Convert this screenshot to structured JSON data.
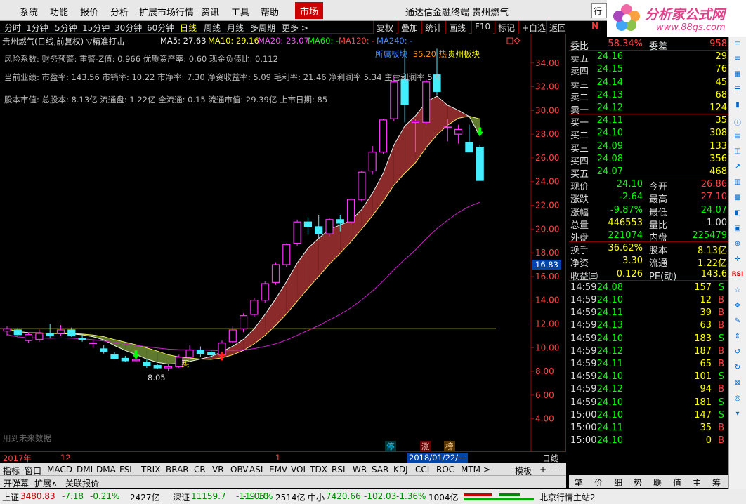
{
  "menu": {
    "items": [
      "系统",
      "功能",
      "报价",
      "分析",
      "扩展市场行情",
      "资讯",
      "工具",
      "帮助"
    ],
    "market": "市场",
    "title": "通达信金融终端   贵州燃气",
    "box": "行"
  },
  "logo": {
    "title": "分析家公式网",
    "url": "www.88gs.com"
  },
  "toolbar": {
    "periods": [
      "分时",
      "1分钟",
      "5分钟",
      "15分钟",
      "30分钟",
      "60分钟",
      "日线",
      "周线",
      "月线",
      "多周期",
      "更多 >"
    ],
    "active": "日线",
    "buttons": [
      "复权",
      "叠加",
      "统计",
      "画线",
      "F10",
      "标记",
      "+自选",
      "返回"
    ]
  },
  "indicators": {
    "header": "贵州燃气(日线,前复权) ▽精准打击",
    "ma5": "MA5: 27.63",
    "ma10": "MA10: 29.16",
    "ma20": "MA20: 23.07",
    "ma60": "MA60: -",
    "ma120": "MA120: -",
    "ma240": "MA240: -"
  },
  "info": {
    "line1": "风险系数: 财务预警: 重警-Z值: 0.966 优质资产率: 0.60 现金负债比: 0.112",
    "line2": "当前业绩: 市盈率: 143.56 市销率: 10.22 市净率: 7.30 净资收益率: 5.09 毛利率: 21.46 净利润率 5.34 主营利润率 5.6",
    "line3": "股本市值: 总股本: 8.13亿 流通盘: 1.22亿 全流通: 0.15 流通市值: 29.39亿 上市日期: 85"
  },
  "annotations": {
    "sector": "所属板块",
    "hot": "35.20 热",
    "block": "贵州板块",
    "low": "8.05",
    "buy": "买",
    "future": "用到未来数据",
    "price_tag": "16.83",
    "stop": "停",
    "rise": "涨",
    "list": "榜"
  },
  "chart_data": {
    "type": "candlestick",
    "ylim": [
      2.5,
      36
    ],
    "y_ticks": [
      4,
      6,
      8,
      10,
      12,
      14,
      16,
      18,
      20,
      22,
      24,
      26,
      28,
      30,
      32,
      34
    ],
    "date_axis": [
      "2017年",
      "12",
      "1",
      "2018/01/22/—"
    ],
    "daily_label": "日线",
    "reference_line": 11.6,
    "candles": [
      [
        11.4,
        11.8,
        11.0,
        11.6
      ],
      [
        11.5,
        11.7,
        10.9,
        11.1
      ],
      [
        10.6,
        11.3,
        10.4,
        11.1
      ],
      [
        10.7,
        11.6,
        10.5,
        11.2
      ],
      [
        11.2,
        12.0,
        10.8,
        11.0
      ],
      [
        11.2,
        11.9,
        11.0,
        11.5
      ],
      [
        11.5,
        11.7,
        10.9,
        11.0
      ],
      [
        10.8,
        11.1,
        10.5,
        10.7
      ],
      [
        10.4,
        10.7,
        10.0,
        10.4
      ],
      [
        9.9,
        10.2,
        9.5,
        9.7
      ],
      [
        9.4,
        9.6,
        9.0,
        9.1
      ],
      [
        9.1,
        9.3,
        8.8,
        8.9
      ],
      [
        8.9,
        9.2,
        8.7,
        9.0
      ],
      [
        8.8,
        9.0,
        8.3,
        8.5
      ],
      [
        8.5,
        8.6,
        8.2,
        8.3
      ],
      [
        8.3,
        8.6,
        8.05,
        8.4
      ],
      [
        8.4,
        9.4,
        8.3,
        9.2
      ],
      [
        9.2,
        10.2,
        9.1,
        9.8
      ],
      [
        9.8,
        10.1,
        9.2,
        9.5
      ],
      [
        9.6,
        9.8,
        9.2,
        9.4
      ],
      [
        9.4,
        10.6,
        9.3,
        10.4
      ],
      [
        10.5,
        11.8,
        10.3,
        11.5
      ],
      [
        11.6,
        12.9,
        11.3,
        12.7
      ],
      [
        12.8,
        14.2,
        12.6,
        14.0
      ],
      [
        14.0,
        15.6,
        13.8,
        15.4
      ],
      [
        15.5,
        17.2,
        15.3,
        17.0
      ],
      [
        17.0,
        18.8,
        16.8,
        18.7
      ],
      [
        18.8,
        20.8,
        18.6,
        20.6
      ],
      [
        20.6,
        21.0,
        19.6,
        20.2
      ],
      [
        20.2,
        21.2,
        19.2,
        19.6
      ],
      [
        19.6,
        20.9,
        19.4,
        20.8
      ],
      [
        20.8,
        21.2,
        19.8,
        20.5
      ],
      [
        20.6,
        22.6,
        20.4,
        22.5
      ],
      [
        22.5,
        24.9,
        22.3,
        24.8
      ],
      [
        24.9,
        27.0,
        24.6,
        26.5
      ],
      [
        26.5,
        29.3,
        26.3,
        29.2
      ],
      [
        29.3,
        32.9,
        29.1,
        32.4
      ],
      [
        32.6,
        35.2,
        29.0,
        30.5
      ],
      [
        29.0,
        29.3,
        26.5,
        29.1
      ],
      [
        29.0,
        32.6,
        28.8,
        32.4
      ],
      [
        33.0,
        35.2,
        31.3,
        31.6
      ],
      [
        28.6,
        29.3,
        27.4,
        28.6
      ],
      [
        28.0,
        28.8,
        27.2,
        28.4
      ],
      [
        27.3,
        28.8,
        26.5,
        26.5
      ],
      [
        26.9,
        27.1,
        24.07,
        24.1
      ]
    ],
    "ma20": [
      [
        8.7
      ],
      [
        9.2
      ]
    ],
    "arrows": [
      [
        12,
        9.0,
        "down"
      ],
      [
        20,
        9.7,
        "up"
      ],
      [
        44,
        27.8,
        "down"
      ]
    ]
  },
  "quotes": {
    "ratio_label": "委比",
    "ratio": "58.34%",
    "diff_label": "委差",
    "diff": "958",
    "asks": [
      [
        "卖五",
        "24.16",
        "29"
      ],
      [
        "卖四",
        "24.15",
        "76"
      ],
      [
        "卖三",
        "24.14",
        "45"
      ],
      [
        "卖二",
        "24.13",
        "68"
      ],
      [
        "卖一",
        "24.12",
        "124"
      ]
    ],
    "bids": [
      [
        "买一",
        "24.11",
        "35"
      ],
      [
        "买二",
        "24.10",
        "308"
      ],
      [
        "买三",
        "24.09",
        "133"
      ],
      [
        "买四",
        "24.08",
        "356"
      ],
      [
        "买五",
        "24.07",
        "468"
      ]
    ],
    "stats": [
      [
        "现价",
        "24.10",
        "今开",
        "26.86"
      ],
      [
        "涨跌",
        "-2.64",
        "最高",
        "27.10"
      ],
      [
        "涨幅",
        "-9.87%",
        "最低",
        "24.07"
      ],
      [
        "总量",
        "446553",
        "量比",
        "1.00"
      ],
      [
        "外盘",
        "221074",
        "内盘",
        "225479"
      ]
    ],
    "stats2": [
      [
        "换手",
        "36.62%",
        "股本",
        "8.13亿"
      ],
      [
        "净资",
        "3.30",
        "流通",
        "1.22亿"
      ],
      [
        "收益㈢",
        "0.126",
        "PE(动)",
        "143.6"
      ]
    ],
    "ticks": [
      [
        "14:59",
        "24.08",
        "157",
        "S"
      ],
      [
        "14:59",
        "24.10",
        "12",
        "B"
      ],
      [
        "14:59",
        "24.11",
        "39",
        "B"
      ],
      [
        "14:59",
        "24.13",
        "63",
        "B"
      ],
      [
        "14:59",
        "24.10",
        "183",
        "S"
      ],
      [
        "14:59",
        "24.12",
        "187",
        "B"
      ],
      [
        "14:59",
        "24.11",
        "65",
        "B"
      ],
      [
        "14:59",
        "24.10",
        "101",
        "S"
      ],
      [
        "14:59",
        "24.12",
        "94",
        "B"
      ],
      [
        "14:59",
        "24.10",
        "181",
        "S"
      ],
      [
        "15:00",
        "24.10",
        "147",
        "S"
      ],
      [
        "15:00",
        "24.11",
        "35",
        "B"
      ],
      [
        "15:00",
        "24.10",
        "0",
        "B"
      ]
    ]
  },
  "indicator_tabs": [
    "指标",
    "窗口",
    "MACD",
    "DMI",
    "DMA",
    "FSL",
    "TRIX",
    "BRAR",
    "CR",
    "VR",
    "OBV",
    "ASI",
    "EMV",
    "VOL-TDX",
    "RSI",
    "WR",
    "SAR",
    "KDJ",
    "CCI",
    "ROC",
    "MTM",
    ">",
    "模板",
    "+",
    "-"
  ],
  "bottom_tabs": [
    "开弹幕",
    "扩展∧",
    "关联报价"
  ],
  "right_tabs": [
    "笔",
    "价",
    "细",
    "势",
    "联",
    "值",
    "主",
    "筹"
  ],
  "status": {
    "sh_label": "上证",
    "sh": "3480.83",
    "sh_chg": "-7.18",
    "sh_pct": "-0.21%",
    "sh_amt": "2427亿",
    "sz_label": "深证",
    "sz": "11159.7",
    "sz_chg": "-119.10",
    "sz_pct": "-1.06%",
    "sz_amt": "2514亿",
    "zx_label": "中小",
    "zx": "7420.66",
    "zx_chg": "-102.03",
    "zx_pct": "-1.36%",
    "zx_amt": "1004亿",
    "server": "北京行情主站2"
  },
  "tools": [
    "N",
    "RSI"
  ]
}
